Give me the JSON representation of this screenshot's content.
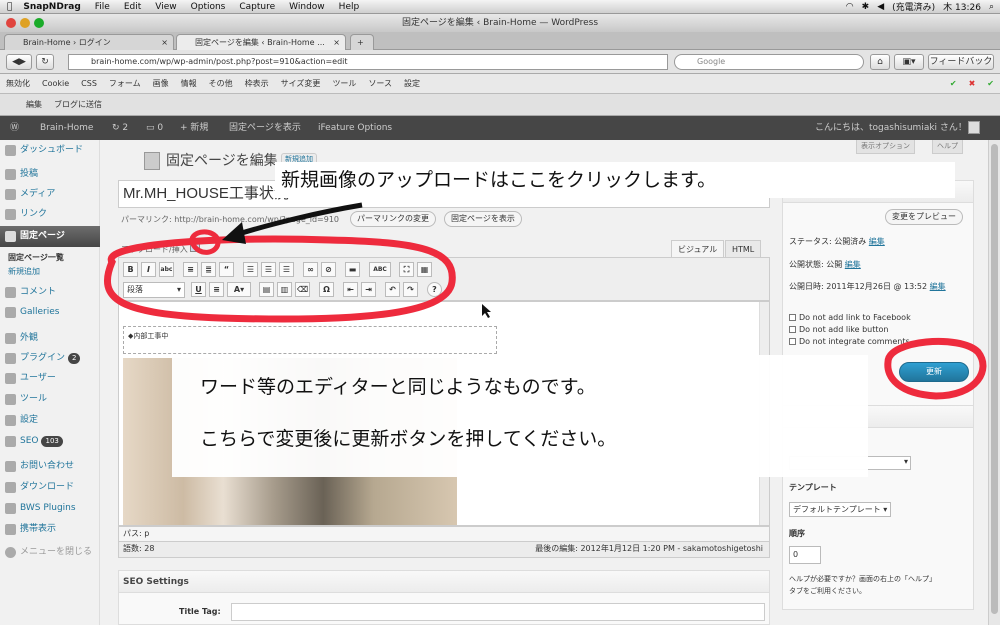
{
  "mac_menu": {
    "app": "SnapNDrag",
    "items": [
      "File",
      "Edit",
      "View",
      "Options",
      "Capture",
      "Window",
      "Help"
    ],
    "charge": "(充電済み)",
    "clock": "木 13:26"
  },
  "window_title": "固定ページを編集 ‹ Brain-Home — WordPress",
  "tabs": [
    {
      "label": "Brain-Home › ログイン"
    },
    {
      "label": "固定ページを編集 ‹ Brain-Home ..."
    }
  ],
  "url": "brain-home.com/wp/wp-admin/post.php?post=910&action=edit",
  "search_placeholder": "Google",
  "feedback": "フィードバック",
  "devbar": [
    "無効化",
    "Cookie",
    "CSS",
    "フォーム",
    "画像",
    "情報",
    "その他",
    "枠表示",
    "サイズ変更",
    "ツール",
    "ソース",
    "設定"
  ],
  "bookmarks": [
    "編集",
    "ブログに送信"
  ],
  "adminbar": {
    "site": "Brain-Home",
    "updates": "2",
    "comments": "0",
    "new": "新規",
    "view": "固定ページを表示",
    "ifeature": "iFeature Options",
    "greeting": "こんにちは、togashisumiaki さん！"
  },
  "screen_options": {
    "screen": "表示オプション",
    "help": "ヘルプ"
  },
  "sidebar": {
    "dashboard": "ダッシュボード",
    "posts": "投稿",
    "media": "メディア",
    "links": "リンク",
    "pages": "固定ページ",
    "pages_sub": [
      "固定ページ一覧",
      "新規追加"
    ],
    "comments": "コメント",
    "galleries": "Galleries",
    "appearance": "外観",
    "plugins": "プラグイン",
    "plugins_count": "2",
    "users": "ユーザー",
    "tools": "ツール",
    "settings": "設定",
    "seo": "SEO",
    "seo_count": "103",
    "contact": "お問い合わせ",
    "download": "ダウンロード",
    "bws": "BWS Plugins",
    "mobile": "携帯表示",
    "collapse": "メニューを閉じる"
  },
  "page": {
    "title": "固定ページを編集",
    "add_new": "新規追加",
    "post_title": "Mr.MH_HOUSE工事状況",
    "permalink": "パーマリンク: http://brain-home.com/wp/?page_id=910",
    "change_permalink": "パーマリンクの変更",
    "view_page": "固定ページを表示",
    "upload": "アップロード/挿入",
    "tab_visual": "ビジュアル",
    "tab_html": "HTML",
    "format": "段落",
    "content_para": "◆内部工事中",
    "path": "パス: p",
    "word_count": "語数: 28",
    "last_edit": "最後の編集: 2012年1月12日 1:20 PM - sakamotoshigetoshi"
  },
  "seo": {
    "heading": "SEO Settings",
    "title_tag": "Title Tag:"
  },
  "publish": {
    "heading": "公開",
    "preview": "変更をプレビュー",
    "status": "ステータス: 公開済み",
    "status_edit": "編集",
    "visibility": "公開状態: 公開",
    "visibility_edit": "編集",
    "date": "公開日時: 2011年12月26日 @ 13:52",
    "date_edit": "編集",
    "fb": "Do not add link to Facebook",
    "like": "Do not add like button",
    "comments": "Do not integrate comments",
    "update": "更新"
  },
  "attributes": {
    "template_label": "テンプレート",
    "template": "デフォルトテンプレート",
    "order_label": "順序",
    "order": "0",
    "help": "ヘルプが必要ですか？画面の右上の「ヘルプ」",
    "help2": "タブをご利用ください。"
  },
  "annotations": {
    "top": "新規画像のアップロードはここをクリックします。",
    "line1": "ワード等のエディターと同じようなものです。",
    "line2": "こちらで変更後に更新ボタンを押してください。"
  },
  "colors": {
    "annotation": "#ee2b3d",
    "admin_bar": "#464646",
    "link": "#21759b",
    "update": "#21759b"
  }
}
